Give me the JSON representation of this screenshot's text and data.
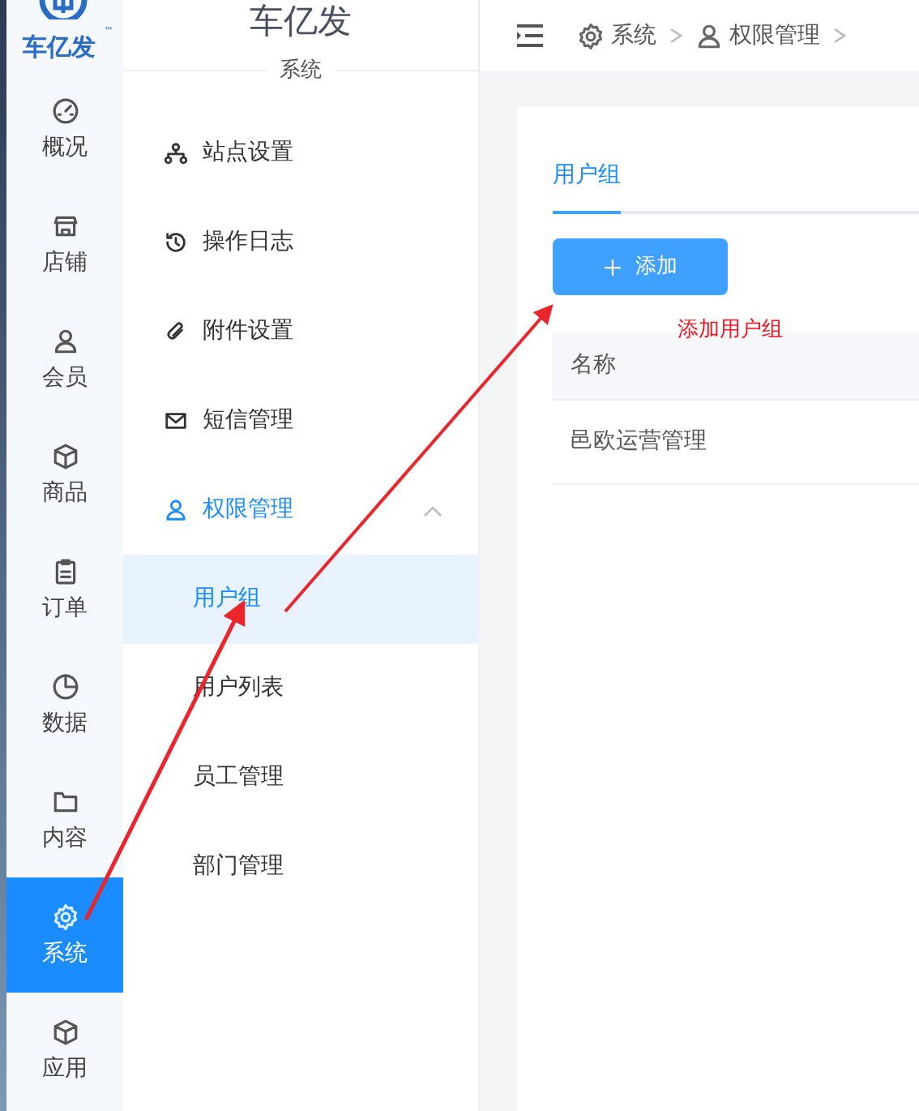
{
  "logo": {
    "name": "车亿发",
    "mark": "™"
  },
  "rail": [
    {
      "label": "概况",
      "kind": "gauge",
      "selected": false
    },
    {
      "label": "店铺",
      "kind": "shop",
      "selected": false
    },
    {
      "label": "会员",
      "kind": "user",
      "selected": false
    },
    {
      "label": "商品",
      "kind": "box",
      "selected": false
    },
    {
      "label": "订单",
      "kind": "clipboard",
      "selected": false
    },
    {
      "label": "数据",
      "kind": "pie",
      "selected": false
    },
    {
      "label": "内容",
      "kind": "folder",
      "selected": false
    },
    {
      "label": "系统",
      "kind": "gear",
      "selected": true
    },
    {
      "label": "应用",
      "kind": "box",
      "selected": false
    }
  ],
  "sidebar": {
    "title": "车亿发",
    "section": "系统",
    "items": [
      {
        "label": "站点设置",
        "kind": "sitemap",
        "selected": false
      },
      {
        "label": "操作日志",
        "kind": "history",
        "selected": false
      },
      {
        "label": "附件设置",
        "kind": "clip",
        "selected": false
      },
      {
        "label": "短信管理",
        "kind": "mail",
        "selected": false
      },
      {
        "label": "权限管理",
        "kind": "user",
        "selected": false,
        "expanded": true,
        "children": [
          {
            "label": "用户组",
            "selected": true
          },
          {
            "label": "用户列表",
            "selected": false
          },
          {
            "label": "员工管理",
            "selected": false
          },
          {
            "label": "部门管理",
            "selected": false
          }
        ]
      }
    ]
  },
  "breadcrumb": [
    {
      "label": "系统",
      "kind": "gear"
    },
    {
      "label": "权限管理",
      "kind": "user"
    }
  ],
  "tabs": [
    {
      "label": "用户组",
      "selected": true
    }
  ],
  "add_button": {
    "label": "添加",
    "kind": "plus"
  },
  "table": {
    "columns": [
      "名称"
    ],
    "rows": [
      [
        "邑欧运营管理"
      ]
    ]
  },
  "annotation": {
    "text": "添加用户组"
  }
}
